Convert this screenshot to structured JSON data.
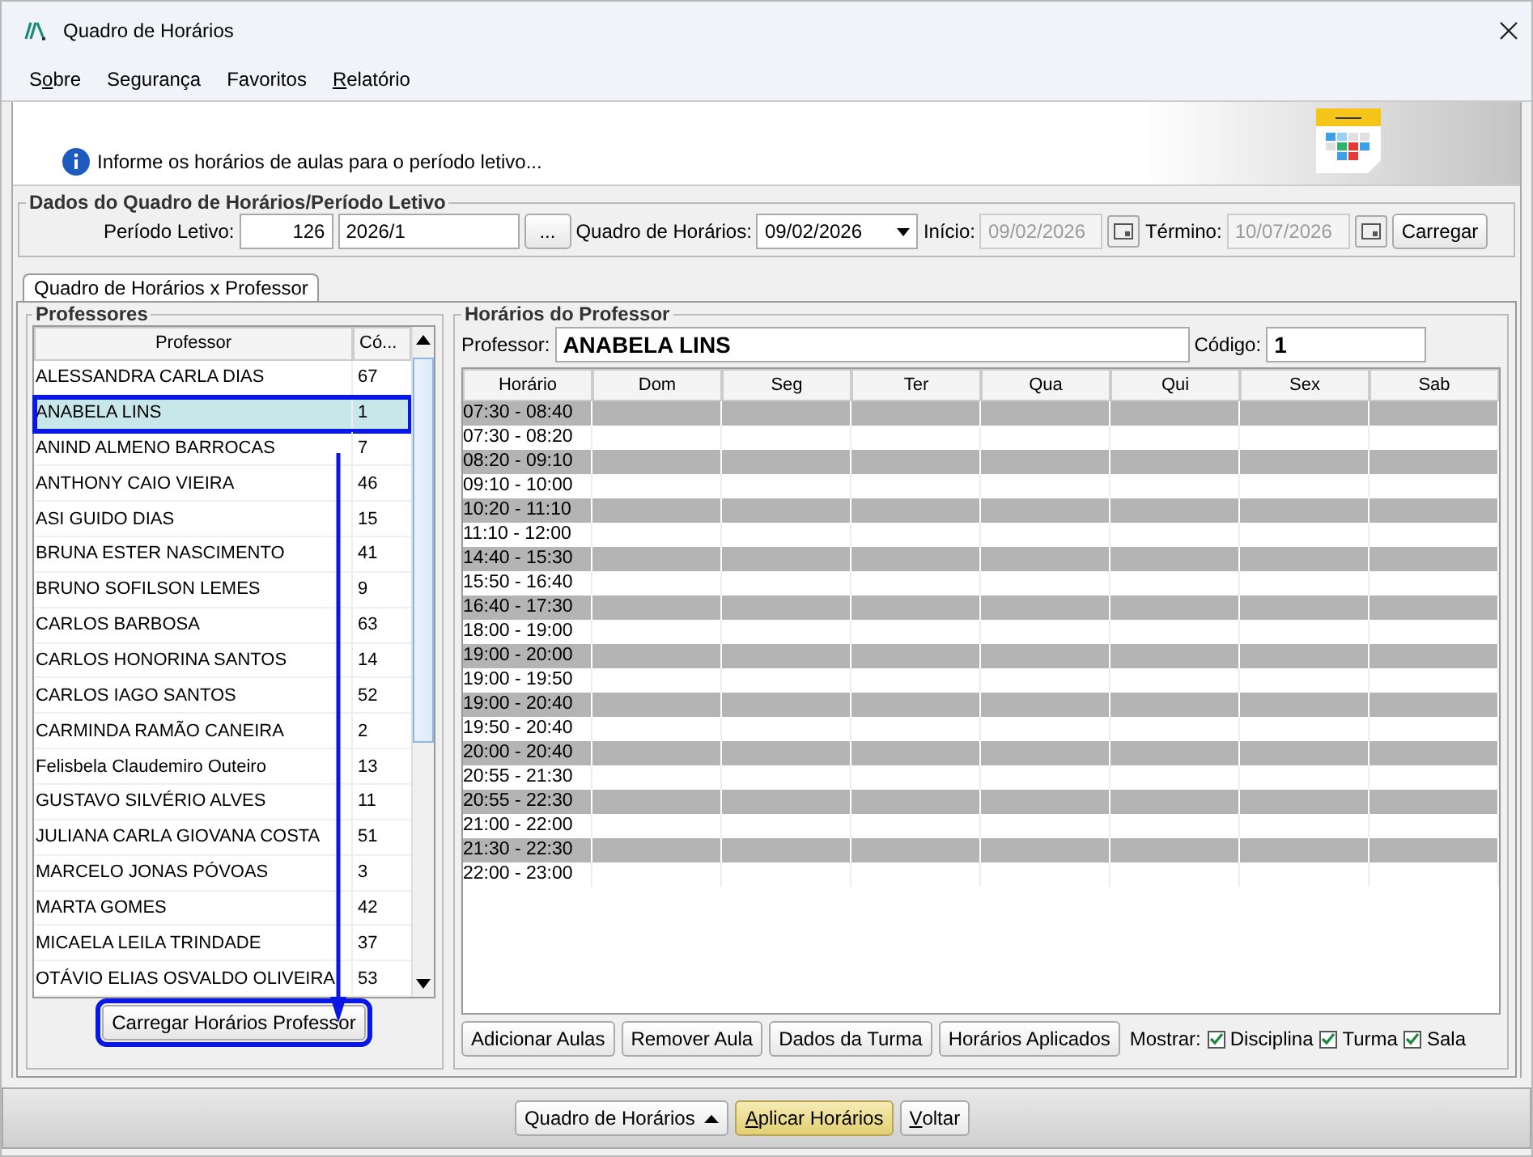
{
  "window": {
    "title": "Quadro de Horários"
  },
  "menu": [
    {
      "label_parts": [
        {
          "text": "S",
          "underlined": false
        },
        {
          "text": "o",
          "underlined": true
        },
        {
          "text": "bre",
          "underlined": false
        }
      ]
    },
    {
      "label_parts": [
        {
          "text": "Segurança",
          "underlined": false
        }
      ]
    },
    {
      "label_parts": [
        {
          "text": "Favoritos",
          "underlined": false
        }
      ]
    },
    {
      "label_parts": [
        {
          "text": "R",
          "underlined": true
        },
        {
          "text": "elatório",
          "underlined": false
        }
      ]
    }
  ],
  "banner": {
    "message": "Informe os horários de aulas para o período letivo..."
  },
  "periodo_group": {
    "title": "Dados do Quadro de Horários/Período Letivo",
    "periodo_label": "Período Letivo:",
    "periodo_code": "126",
    "periodo_name": "2026/1",
    "browse_button": "...",
    "quadro_label": "Quadro de Horários:",
    "quadro_value": "09/02/2026",
    "inicio_label": "Início:",
    "inicio_value": "09/02/2026",
    "termino_label": "Término:",
    "termino_value": "10/07/2026",
    "load_button": "Carregar"
  },
  "tabs": [
    {
      "label": "Quadro de Horários x Professor",
      "selected": true
    }
  ],
  "professors": {
    "title": "Professores",
    "columns": [
      "Professor",
      "Có..."
    ],
    "rows": [
      {
        "name": "ALESSANDRA CARLA DIAS",
        "code": "67",
        "selected": false
      },
      {
        "name": "ANABELA LINS",
        "code": "1",
        "selected": true
      },
      {
        "name": "ANIND ALMENO BARROCAS",
        "code": "7",
        "selected": false
      },
      {
        "name": "ANTHONY CAIO VIEIRA",
        "code": "46",
        "selected": false
      },
      {
        "name": "ASI GUIDO DIAS",
        "code": "15",
        "selected": false
      },
      {
        "name": "BRUNA ESTER NASCIMENTO",
        "code": "41",
        "selected": false
      },
      {
        "name": "BRUNO SOFILSON LEMES",
        "code": "9",
        "selected": false
      },
      {
        "name": "CARLOS BARBOSA",
        "code": "63",
        "selected": false
      },
      {
        "name": "CARLOS HONORINA SANTOS",
        "code": "14",
        "selected": false
      },
      {
        "name": "CARLOS IAGO SANTOS",
        "code": "52",
        "selected": false
      },
      {
        "name": "CARMINDA RAMÃO CANEIRA",
        "code": "2",
        "selected": false
      },
      {
        "name": "Felisbela Claudemiro Outeiro",
        "code": "13",
        "selected": false
      },
      {
        "name": "GUSTAVO SILVÉRIO ALVES",
        "code": "11",
        "selected": false
      },
      {
        "name": "JULIANA CARLA GIOVANA COSTA",
        "code": "51",
        "selected": false
      },
      {
        "name": "MARCELO JONAS PÓVOAS",
        "code": "3",
        "selected": false
      },
      {
        "name": "MARTA GOMES",
        "code": "42",
        "selected": false
      },
      {
        "name": "MICAELA LEILA TRINDADE",
        "code": "37",
        "selected": false
      },
      {
        "name": "OTÁVIO ELIAS OSVALDO OLIVEIRA",
        "code": "53",
        "selected": false
      }
    ],
    "load_button": {
      "label": "Carregar Horários Professor",
      "highlighted": true
    }
  },
  "schedule": {
    "title": "Horários do Professor",
    "professor_label": "Professor:",
    "professor_value": "ANABELA LINS",
    "code_label": "Código:",
    "code_value": "1",
    "columns": [
      "Horário",
      "Dom",
      "Seg",
      "Ter",
      "Qua",
      "Qui",
      "Sex",
      "Sab"
    ],
    "rows": [
      {
        "time": "07:30 - 08:40",
        "shaded": true
      },
      {
        "time": "07:30 - 08:20",
        "shaded": false
      },
      {
        "time": "08:20 - 09:10",
        "shaded": true
      },
      {
        "time": "09:10 - 10:00",
        "shaded": false
      },
      {
        "time": "10:20 - 11:10",
        "shaded": true
      },
      {
        "time": "11:10 - 12:00",
        "shaded": false
      },
      {
        "time": "14:40 - 15:30",
        "shaded": true
      },
      {
        "time": "15:50 - 16:40",
        "shaded": false
      },
      {
        "time": "16:40 - 17:30",
        "shaded": true
      },
      {
        "time": "18:00 - 19:00",
        "shaded": false
      },
      {
        "time": "19:00 - 20:00",
        "shaded": true
      },
      {
        "time": "19:00 - 19:50",
        "shaded": false
      },
      {
        "time": "19:00 - 20:40",
        "shaded": true
      },
      {
        "time": "19:50 - 20:40",
        "shaded": false
      },
      {
        "time": "20:00 - 20:40",
        "shaded": true
      },
      {
        "time": "20:55 - 21:30",
        "shaded": false
      },
      {
        "time": "20:55 - 22:30",
        "shaded": true
      },
      {
        "time": "21:00 - 22:00",
        "shaded": false
      },
      {
        "time": "21:30 - 22:30",
        "shaded": true
      },
      {
        "time": "22:00 - 23:00",
        "shaded": false
      }
    ],
    "buttons": [
      "Adicionar Aulas",
      "Remover Aula",
      "Dados da Turma",
      "Horários Aplicados"
    ],
    "show_label": "Mostrar:",
    "show_options": [
      {
        "label": "Disciplina",
        "checked": true
      },
      {
        "label": "Turma",
        "checked": true
      },
      {
        "label": "Sala",
        "checked": true
      }
    ]
  },
  "footer": {
    "buttons": [
      {
        "label_parts": [
          {
            "text": "Quadro de Horários",
            "underlined": false
          }
        ],
        "kind": "dropdown"
      },
      {
        "label_parts": [
          {
            "text": "A",
            "underlined": true
          },
          {
            "text": "plicar Horários",
            "underlined": false
          }
        ],
        "kind": "primary"
      },
      {
        "label_parts": [
          {
            "text": "V",
            "underlined": true
          },
          {
            "text": "oltar",
            "underlined": false
          }
        ],
        "kind": "normal"
      }
    ]
  }
}
